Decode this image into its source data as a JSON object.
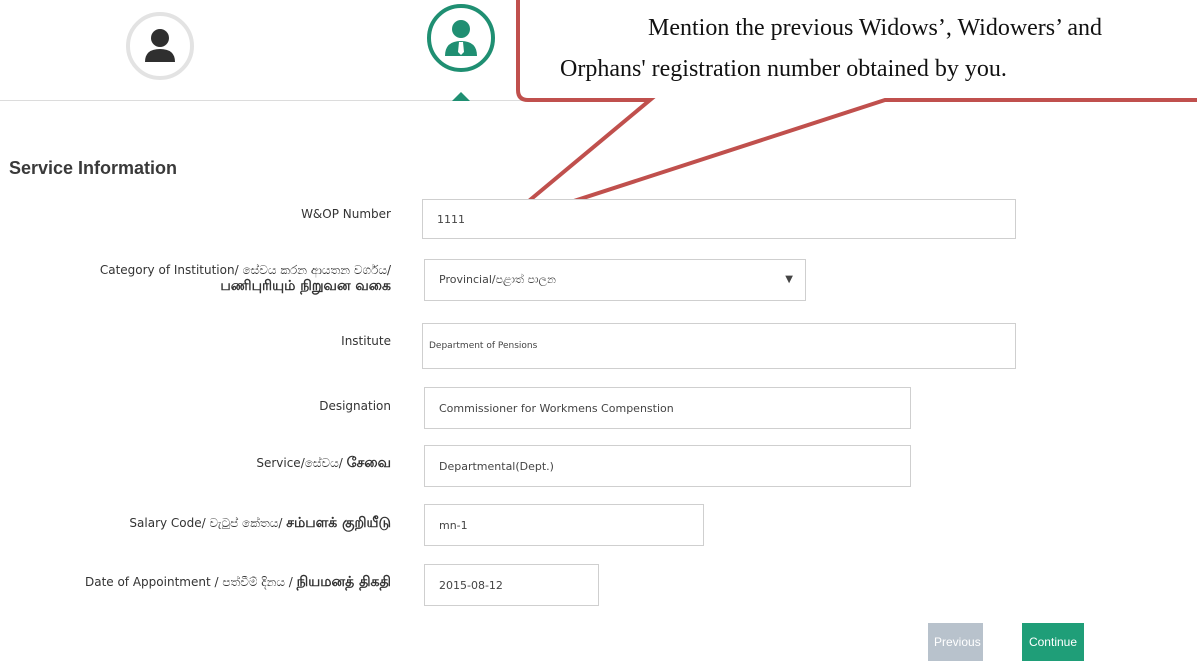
{
  "callout": {
    "line1": "Mention the previous Widows’, Widowers’ and",
    "line2": "Orphans' registration number obtained by you."
  },
  "stepper": {
    "steps": [
      {
        "icon": "person-icon",
        "state": "inactive"
      },
      {
        "icon": "person-tie-icon",
        "state": "active"
      }
    ],
    "colors": {
      "active": "#1f8f72",
      "inactive": "#e3e3e3"
    }
  },
  "section": {
    "title": "Service Information"
  },
  "form": {
    "wop_label": "W&OP Number",
    "wop_value": "1111",
    "category_label_1": "Category of Institution/ සේවය කරන ආයතන වර්ගය/",
    "category_label_2": "பணிபுரியும் நிறுவன வகை",
    "category_value": "Provincial/පළාත් පාලන",
    "institute_label": "Institute",
    "institute_value": "Department of Pensions",
    "designation_label": "Designation",
    "designation_value": "Commissioner for Workmens Compenstion",
    "service_label_1": "Service/සේවය/ ",
    "service_label_2": "சேவை",
    "service_value": "Departmental(Dept.)",
    "salary_label_1": "Salary Code/ වැටුප් කේතය/ ",
    "salary_label_2": "சம்பளக் குறியீடு",
    "salary_value": "mn-1",
    "doa_label_1": "Date of Appointment / පත්වීම් දිනය / ",
    "doa_label_2": "நியமனத் திகதி",
    "doa_value": "2015-08-12"
  },
  "buttons": {
    "previous": "Previous",
    "continue": "Continue"
  }
}
